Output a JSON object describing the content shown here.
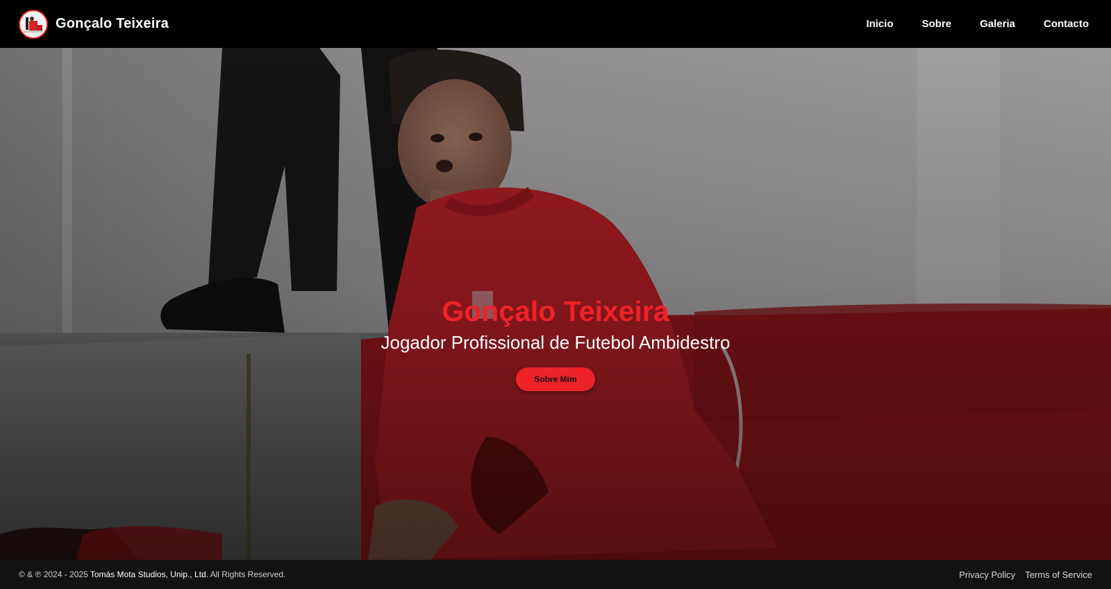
{
  "header": {
    "logo_icon": "player-logo-icon",
    "brand_name": "Gonçalo Teixeira",
    "nav": [
      {
        "label": "Inicio"
      },
      {
        "label": "Sobre"
      },
      {
        "label": "Galeria"
      },
      {
        "label": "Contacto"
      }
    ]
  },
  "hero": {
    "title": "Gonçalo Teixeira",
    "subtitle": "Jogador Profissional de Futebol Ambidestro",
    "button_label": "Sobre Mim"
  },
  "footer": {
    "copyright_prefix": "© & ℗ 2024 - 2025",
    "company": "Tomás Mota Studios, Unip., Ltd.",
    "rights": "All Rights Reserved.",
    "links": [
      {
        "label": "Privacy Policy"
      },
      {
        "label": "Terms of Service"
      }
    ]
  },
  "colors": {
    "accent": "#ee2229",
    "navbar_bg": "#000000",
    "footer_bg": "#121212"
  }
}
